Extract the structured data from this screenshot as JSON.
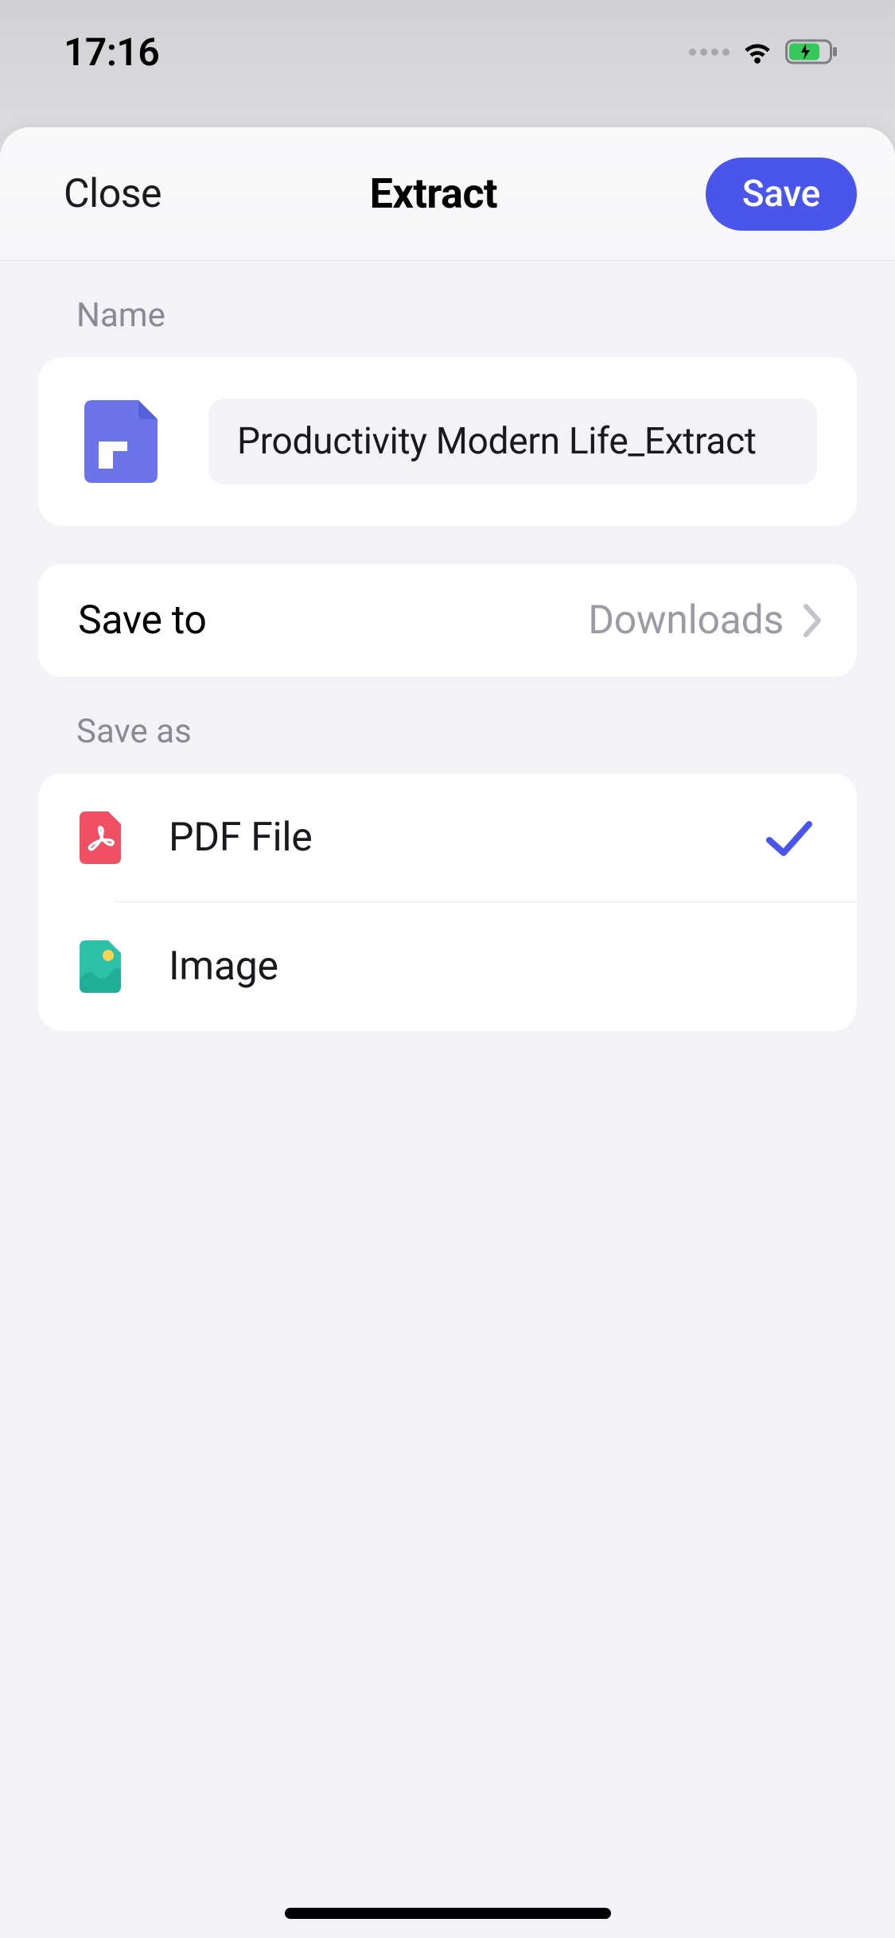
{
  "statusBar": {
    "time": "17:16"
  },
  "header": {
    "close": "Close",
    "title": "Extract",
    "save": "Save"
  },
  "sections": {
    "nameLabel": "Name",
    "fileName": "Productivity Modern Life_Extract",
    "saveToLabel": "Save to",
    "saveToValue": "Downloads",
    "saveAsLabel": "Save as",
    "formats": {
      "pdf": {
        "label": "PDF File",
        "selected": true
      },
      "image": {
        "label": "Image",
        "selected": false
      }
    }
  }
}
